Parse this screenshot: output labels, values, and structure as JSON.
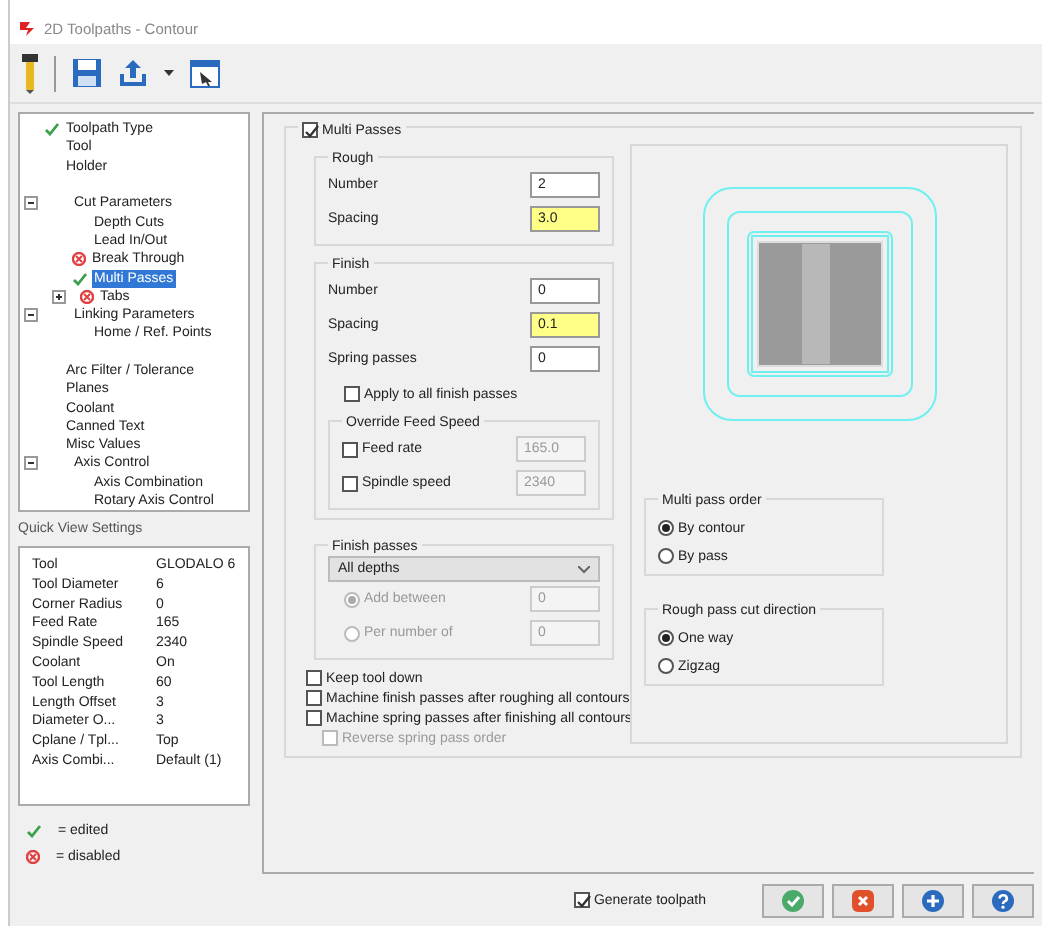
{
  "window": {
    "title": "2D Toolpaths - Contour"
  },
  "tree": [
    {
      "label": "Toolpath Type",
      "edited": true,
      "disabled": false,
      "selected": false
    },
    {
      "label": "Tool",
      "edited": false,
      "disabled": false,
      "selected": false
    },
    {
      "label": "Holder",
      "edited": false,
      "disabled": false,
      "selected": false,
      "blank_row_after": true
    },
    {
      "label": "Cut Parameters",
      "edited": false,
      "disabled": false,
      "selected": false,
      "expanded": true,
      "children": [
        {
          "label": "Depth Cuts",
          "edited": false,
          "disabled": false,
          "selected": false
        },
        {
          "label": "Lead In/Out",
          "edited": false,
          "disabled": false,
          "selected": false
        },
        {
          "label": "Break Through",
          "edited": false,
          "disabled": true,
          "selected": false
        },
        {
          "label": "Multi Passes",
          "edited": true,
          "disabled": false,
          "selected": true
        },
        {
          "label": "Tabs",
          "edited": false,
          "disabled": true,
          "selected": false,
          "expanded": false
        }
      ]
    },
    {
      "label": "Linking Parameters",
      "edited": false,
      "disabled": false,
      "selected": false,
      "expanded": true,
      "children": [
        {
          "label": "Home / Ref. Points",
          "edited": false,
          "disabled": false,
          "selected": false,
          "blank_row_after": true
        }
      ]
    },
    {
      "label": "Arc Filter / Tolerance",
      "edited": false,
      "disabled": false,
      "selected": false
    },
    {
      "label": "Planes",
      "edited": false,
      "disabled": false,
      "selected": false
    },
    {
      "label": "Coolant",
      "edited": false,
      "disabled": false,
      "selected": false
    },
    {
      "label": "Canned Text",
      "edited": false,
      "disabled": false,
      "selected": false
    },
    {
      "label": "Misc Values",
      "edited": false,
      "disabled": false,
      "selected": false
    },
    {
      "label": "Axis Control",
      "edited": false,
      "disabled": false,
      "selected": false,
      "expanded": true,
      "children": [
        {
          "label": "Axis Combination",
          "edited": false,
          "disabled": false,
          "selected": false
        },
        {
          "label": "Rotary Axis Control",
          "edited": false,
          "disabled": false,
          "selected": false
        }
      ]
    }
  ],
  "quick_view": {
    "title": "Quick View Settings",
    "rows": [
      {
        "name": "Tool",
        "value": "GLODALO 6"
      },
      {
        "name": "Tool Diameter",
        "value": "6"
      },
      {
        "name": "Corner Radius",
        "value": "0"
      },
      {
        "name": "Feed Rate",
        "value": "165"
      },
      {
        "name": "Spindle Speed",
        "value": "2340"
      },
      {
        "name": "Coolant",
        "value": "On"
      },
      {
        "name": "Tool Length",
        "value": "60"
      },
      {
        "name": "Length Offset",
        "value": "3"
      },
      {
        "name": "Diameter O...",
        "value": "3"
      },
      {
        "name": "Cplane / Tpl...",
        "value": "Top"
      },
      {
        "name": "Axis Combi...",
        "value": "Default (1)"
      }
    ]
  },
  "legend": [
    {
      "kind": "edited",
      "label": "= edited"
    },
    {
      "kind": "disabled",
      "label": "= disabled"
    }
  ],
  "multi_passes": {
    "label": "Multi Passes",
    "checked": true,
    "rough": {
      "title": "Rough",
      "fields": [
        {
          "label": "Number",
          "value": "2",
          "highlighted": false
        },
        {
          "label": "Spacing",
          "value": "3.0",
          "highlighted": true
        }
      ]
    },
    "finish": {
      "title": "Finish",
      "fields": [
        {
          "label": "Number",
          "value": "0",
          "highlighted": false
        },
        {
          "label": "Spacing",
          "value": "0.1",
          "highlighted": true
        },
        {
          "label": "Spring passes",
          "value": "0",
          "highlighted": false
        }
      ],
      "apply_all": {
        "label": "Apply to all finish passes",
        "checked": false
      },
      "override": {
        "title": "Override Feed Speed",
        "rows": [
          {
            "label": "Feed rate",
            "checked": false,
            "value": "165.0",
            "disabled": true
          },
          {
            "label": "Spindle speed",
            "checked": false,
            "value": "2340",
            "disabled": true
          }
        ]
      }
    },
    "finish_passes": {
      "title": "Finish passes",
      "select": "All depths",
      "options": [
        {
          "label": "Add between",
          "selected": true,
          "disabled": true,
          "value": "0"
        },
        {
          "label": "Per number of",
          "selected": false,
          "disabled": true,
          "value": "0"
        }
      ]
    },
    "options": [
      {
        "label": "Keep tool down",
        "checked": false,
        "disabled": false
      },
      {
        "label": "Machine finish passes after roughing all contours",
        "checked": false,
        "disabled": false
      },
      {
        "label": "Machine spring passes after finishing all contours",
        "checked": false,
        "disabled": false,
        "children": [
          {
            "label": "Reverse spring pass order",
            "checked": false,
            "disabled": true
          }
        ]
      }
    ],
    "pass_order": {
      "title": "Multi pass order",
      "options": [
        {
          "label": "By contour",
          "selected": true
        },
        {
          "label": "By pass",
          "selected": false
        }
      ]
    },
    "cut_direction": {
      "title": "Rough pass cut direction",
      "options": [
        {
          "label": "One way",
          "selected": true
        },
        {
          "label": "Zigzag",
          "selected": false
        }
      ]
    }
  },
  "footer": {
    "generate": {
      "label": "Generate toolpath",
      "checked": true
    }
  }
}
